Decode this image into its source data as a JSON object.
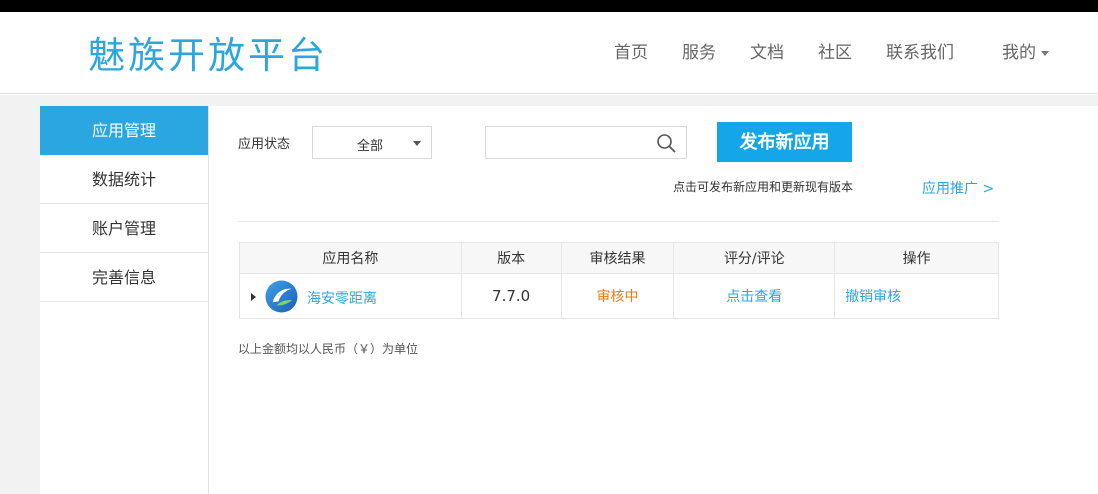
{
  "header": {
    "logo": "魅族开放平台",
    "nav": [
      {
        "label": "首页"
      },
      {
        "label": "服务"
      },
      {
        "label": "文档"
      },
      {
        "label": "社区"
      },
      {
        "label": "联系我们"
      }
    ],
    "user_menu": "我的"
  },
  "sidebar": {
    "items": [
      {
        "label": "应用管理",
        "active": true
      },
      {
        "label": "数据统计"
      },
      {
        "label": "账户管理"
      },
      {
        "label": "完善信息"
      }
    ]
  },
  "filters": {
    "status_label": "应用状态",
    "status_value": "全部",
    "search_value": "",
    "search_placeholder": ""
  },
  "actions": {
    "publish_label": "发布新应用",
    "publish_hint": "点击可发布新应用和更新现有版本",
    "promo_link": "应用推广 >"
  },
  "table": {
    "headers": [
      "应用名称",
      "版本",
      "审核结果",
      "评分/评论",
      "操作"
    ],
    "rows": [
      {
        "name": "海安零距离",
        "version": "7.7.0",
        "review": "审核中",
        "rating_link": "点击查看",
        "operation": "撤销审核"
      }
    ]
  },
  "footnote": "以上金额均以人民币（￥）为单位",
  "colors": {
    "accent": "#2aa7e0",
    "button": "#14a6e9",
    "pending": "#e87d1a"
  }
}
